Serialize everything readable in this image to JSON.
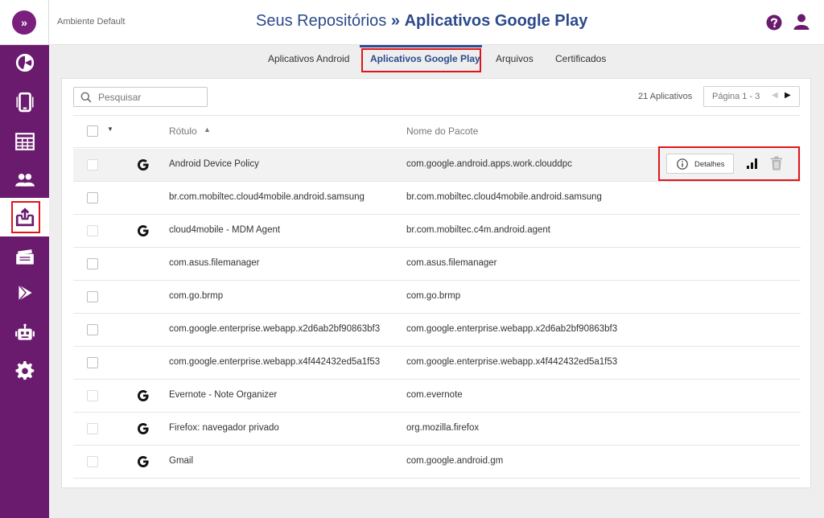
{
  "header": {
    "environment": "Ambiente Default",
    "title_prefix": "Seus Repositórios",
    "title_separator": "»",
    "title_current": "Aplicativos Google Play"
  },
  "sidebar": {
    "logo": "»",
    "items": [
      {
        "icon": "pie-chart-icon"
      },
      {
        "icon": "device-icon"
      },
      {
        "icon": "table-icon"
      },
      {
        "icon": "users-icon"
      },
      {
        "icon": "app-upload-icon",
        "active": true
      },
      {
        "icon": "tickets-icon"
      },
      {
        "icon": "play-icon"
      },
      {
        "icon": "robot-icon"
      },
      {
        "icon": "gear-icon"
      }
    ]
  },
  "tabs": [
    {
      "label": "Aplicativos Android"
    },
    {
      "label": "Aplicativos Google Play",
      "active": true
    },
    {
      "label": "Arquivos"
    },
    {
      "label": "Certificados"
    }
  ],
  "search": {
    "placeholder": "Pesquisar",
    "value": ""
  },
  "count_label": "21 Aplicativos",
  "pager": {
    "label": "Página 1 - 3",
    "prev": "◀",
    "next": "▶"
  },
  "table": {
    "columns": {
      "label": "Rótulo",
      "package": "Nome do Pacote"
    },
    "rows": [
      {
        "label": "Android Device Policy",
        "package": "com.google.android.apps.work.clouddpc",
        "google": true
      },
      {
        "label": "br.com.mobiltec.cloud4mobile.android.samsung",
        "package": "br.com.mobiltec.cloud4mobile.android.samsung",
        "google": false
      },
      {
        "label": "cloud4mobile - MDM Agent",
        "package": "br.com.mobiltec.c4m.android.agent",
        "google": true
      },
      {
        "label": "com.asus.filemanager",
        "package": "com.asus.filemanager",
        "google": false
      },
      {
        "label": "com.go.brmp",
        "package": "com.go.brmp",
        "google": false
      },
      {
        "label": "com.google.enterprise.webapp.x2d6ab2bf90863bf3",
        "package": "com.google.enterprise.webapp.x2d6ab2bf90863bf3",
        "google": false
      },
      {
        "label": "com.google.enterprise.webapp.x4f442432ed5a1f53",
        "package": "com.google.enterprise.webapp.x4f442432ed5a1f53",
        "google": false
      },
      {
        "label": "Evernote - Note Organizer",
        "package": "com.evernote",
        "google": true
      },
      {
        "label": "Firefox: navegador privado",
        "package": "org.mozilla.firefox",
        "google": true
      },
      {
        "label": "Gmail",
        "package": "com.google.android.gm",
        "google": true
      }
    ]
  },
  "row_actions": {
    "details_label": "Detalhes"
  },
  "colors": {
    "sidebar": "#6a1b6e",
    "title": "#2c4a8c",
    "highlight": "#e0151b"
  }
}
